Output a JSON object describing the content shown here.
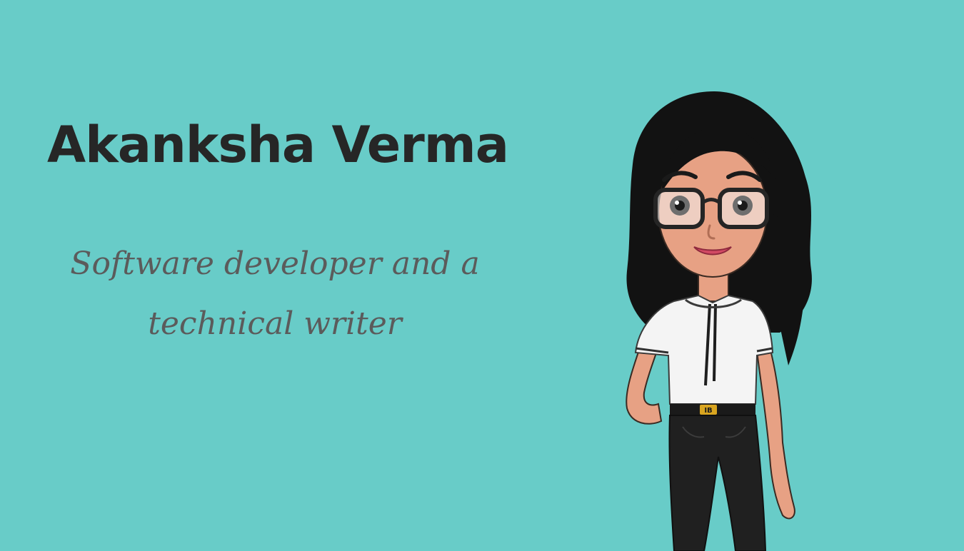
{
  "profile": {
    "name": "Akanksha Verma",
    "tagline_line1": "Software developer and a",
    "tagline_line2": "technical writer"
  },
  "theme": {
    "background": "#68ccc8",
    "heading_color": "#262626",
    "tagline_color": "#5b5b5b"
  },
  "avatar": {
    "icon": "cartoon-woman-avatar-illustration",
    "hair_color": "#121212",
    "skin_color": "#e7a184",
    "shirt_color": "#f4f4f4",
    "trousers_color": "#202020",
    "belt_buckle_color": "#d9a520",
    "belt_buckle_text": "IB"
  }
}
